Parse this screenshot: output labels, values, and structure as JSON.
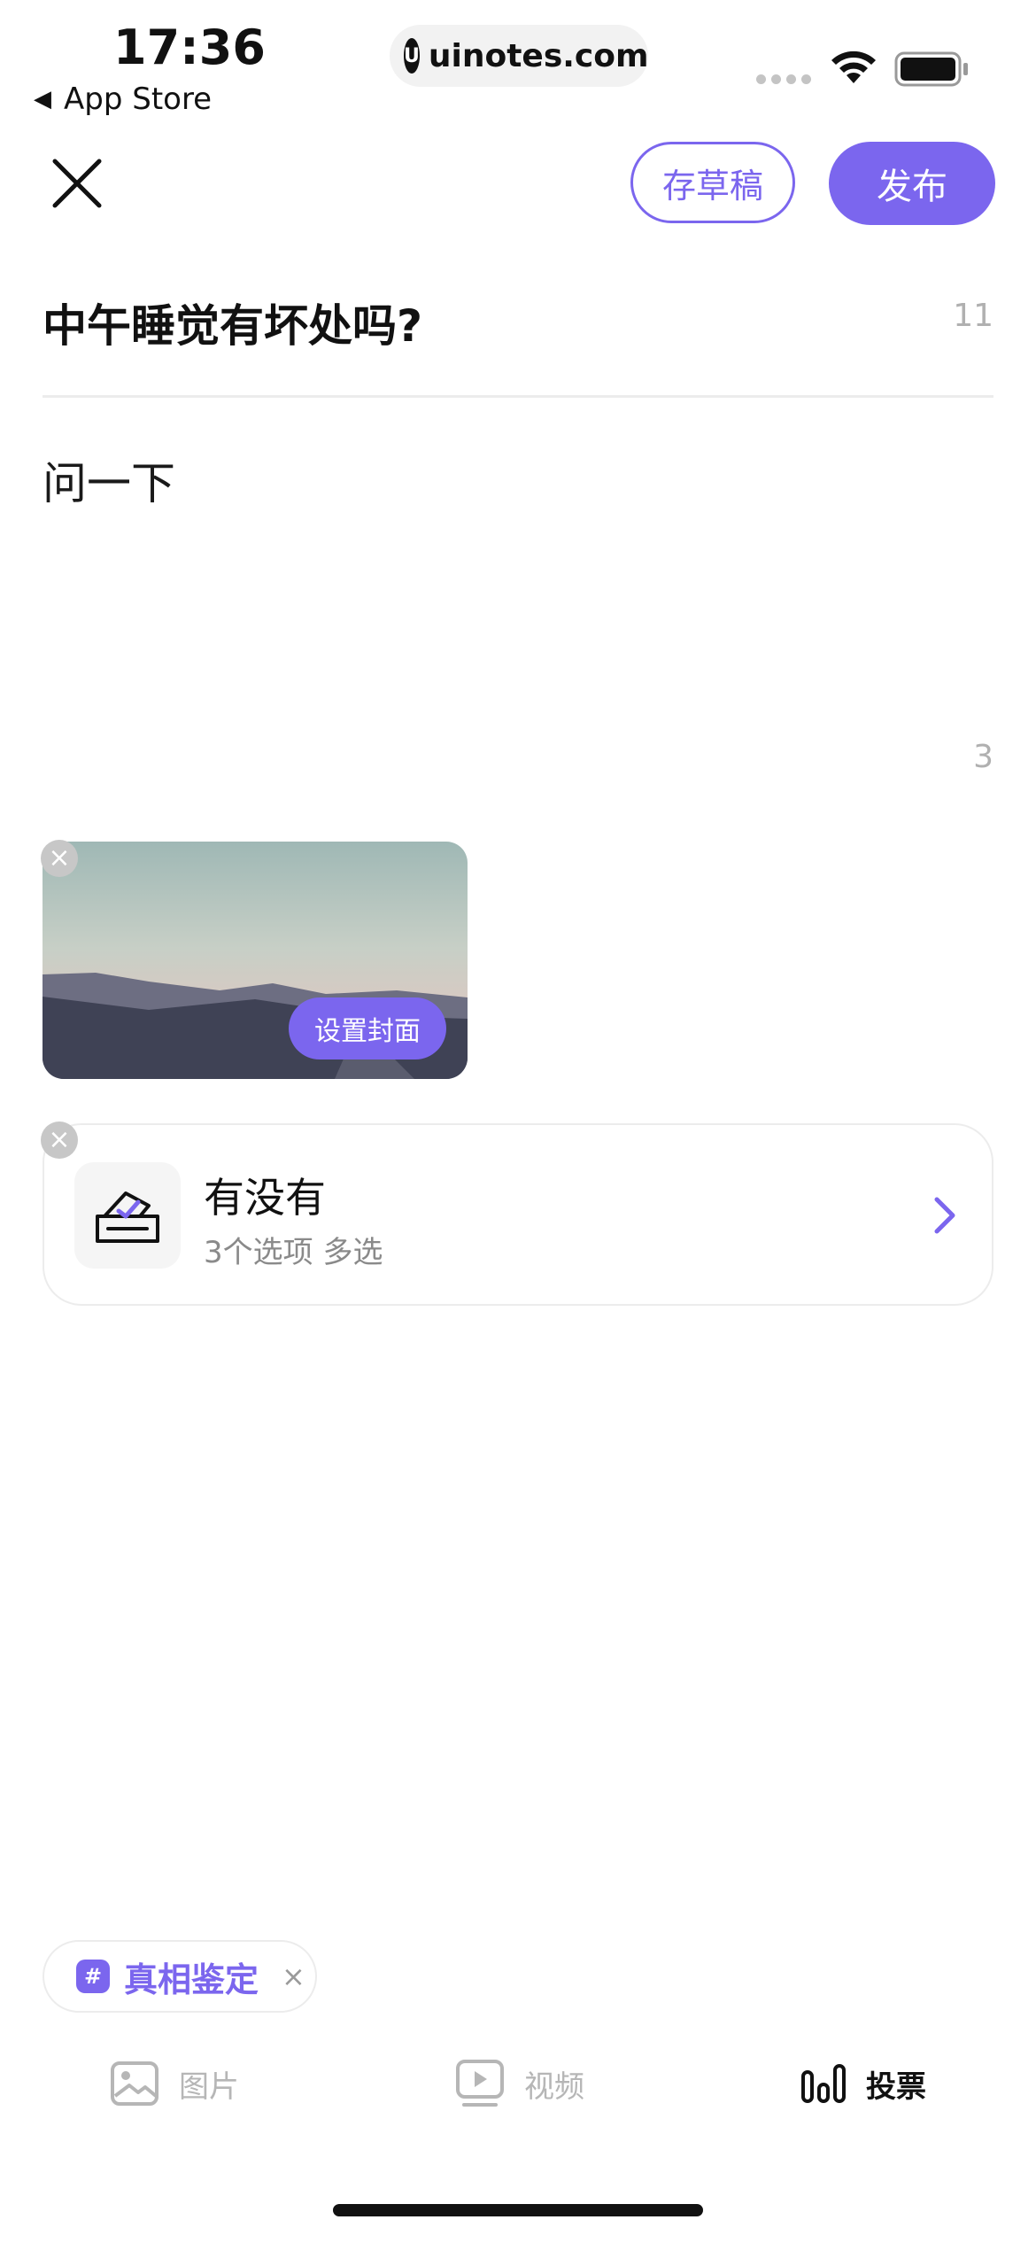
{
  "status_bar": {
    "time": "17:36",
    "back_label": "App Store",
    "url": "uinotes.com",
    "url_logo": "U"
  },
  "toolbar": {
    "close_icon": "close-icon",
    "draft_label": "存草稿",
    "publish_label": "发布"
  },
  "post": {
    "title": "中午睡觉有坏处吗?",
    "title_count": "11",
    "body": "问一下",
    "body_count": "3"
  },
  "media": {
    "cover_label": "设置封面"
  },
  "vote": {
    "title": "有没有",
    "subtitle": "3个选项 多选"
  },
  "topic": {
    "icon": "#",
    "label": "真相鉴定",
    "close": "×"
  },
  "tools": {
    "image_label": "图片",
    "video_label": "视频",
    "vote_label": "投票"
  },
  "colors": {
    "accent": "#7b66ee",
    "muted": "#b6b6b6"
  }
}
